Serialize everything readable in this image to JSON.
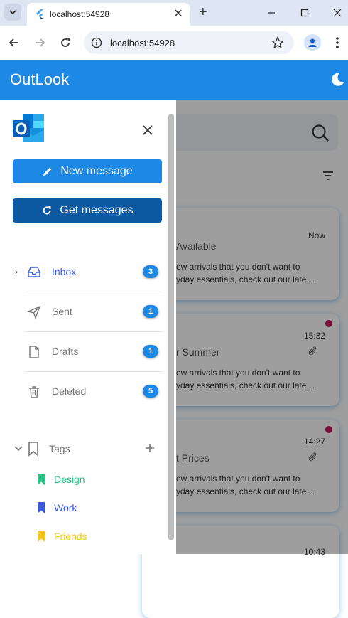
{
  "browser": {
    "tab_title": "localhost:54928",
    "url": "localhost:54928"
  },
  "app": {
    "title": "OutLook"
  },
  "drawer": {
    "new_message_label": "New message",
    "get_messages_label": "Get messages",
    "folders": [
      {
        "label": "Inbox",
        "count": "3"
      },
      {
        "label": "Sent",
        "count": "1"
      },
      {
        "label": "Drafts",
        "count": "1"
      },
      {
        "label": "Deleted",
        "count": "5"
      }
    ],
    "tags_label": "Tags",
    "tags": [
      {
        "label": "Design",
        "color": "#26c281"
      },
      {
        "label": "Work",
        "color": "#3b5bdb"
      },
      {
        "label": "Friends",
        "color": "#f5c518"
      }
    ]
  },
  "messages": [
    {
      "time": "Now",
      "subject": "Available",
      "preview": "ew arrivals that you don't want to\nyday essentials, check out our late…"
    },
    {
      "time": "15:32",
      "subject": "r Summer",
      "preview": "ew arrivals that you don't want to\nyday essentials, check out our late…"
    },
    {
      "time": "14:27",
      "subject": "t Prices",
      "preview": "ew arrivals that you don't want to\nyday essentials, check out our late…"
    },
    {
      "time": "10:43"
    }
  ],
  "colors": {
    "primary": "#1e88e5",
    "primary_dark": "#0d5aa3",
    "unread": "#c2185b"
  }
}
